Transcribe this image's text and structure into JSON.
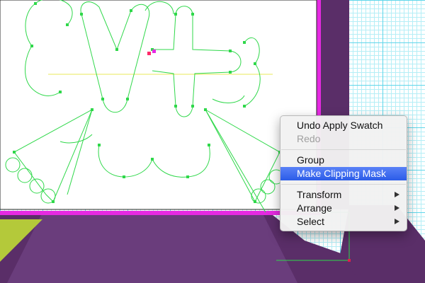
{
  "colors": {
    "purple_panel": "#5a2e68",
    "purple_light": "#6a3d7c",
    "magenta_frame": "#e62ae2",
    "lime_shape": "#b4c93a",
    "path_green": "#2fd84a",
    "guide_yellow": "#f0f05a",
    "menu_highlight": "#2b5ce8"
  },
  "context_menu": {
    "undo": "Undo Apply Swatch",
    "redo": "Redo",
    "group": "Group",
    "make_clipping_mask": "Make Clipping Mask",
    "transform": "Transform",
    "arrange": "Arrange",
    "select": "Select",
    "highlighted_item": "Make Clipping Mask",
    "submenu_icon": "triangle-right-icon"
  }
}
